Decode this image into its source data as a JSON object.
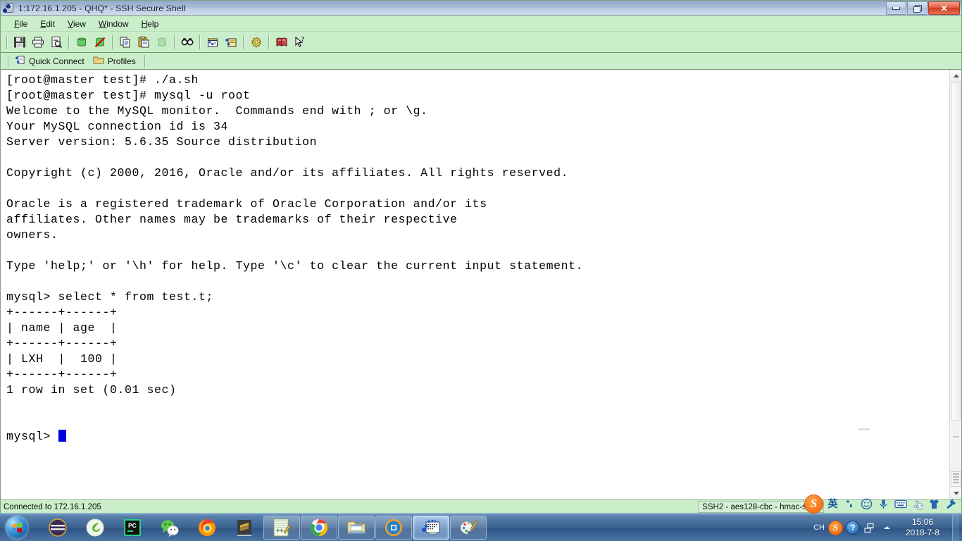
{
  "window": {
    "title": "1:172.16.1.205 - QHQ* - SSH Secure Shell",
    "app_icon": "ssh-terminal-icon",
    "controls": {
      "minimize": "Minimize",
      "restore": "Restore",
      "close": "Close"
    }
  },
  "menu": {
    "items": [
      {
        "label": "File",
        "accel": "F"
      },
      {
        "label": "Edit",
        "accel": "E"
      },
      {
        "label": "View",
        "accel": "V"
      },
      {
        "label": "Window",
        "accel": "W"
      },
      {
        "label": "Help",
        "accel": "H"
      }
    ]
  },
  "toolbar": {
    "buttons": [
      {
        "name": "save-icon",
        "title": "Save"
      },
      {
        "name": "print-icon",
        "title": "Print"
      },
      {
        "name": "print-preview-icon",
        "title": "Print Preview"
      },
      {
        "name": "connect-icon",
        "title": "Connect"
      },
      {
        "name": "disconnect-icon",
        "title": "Disconnect"
      },
      {
        "name": "copy-icon",
        "title": "Copy"
      },
      {
        "name": "paste-icon",
        "title": "Paste"
      },
      {
        "name": "new-terminal-icon",
        "title": "New Terminal"
      },
      {
        "name": "find-icon",
        "title": "Find"
      },
      {
        "name": "file-transfer-icon",
        "title": "New File Transfer"
      },
      {
        "name": "upload-dialog-icon",
        "title": "Upload Dialog"
      },
      {
        "name": "settings-icon",
        "title": "Settings"
      },
      {
        "name": "help-book-icon",
        "title": "Help"
      },
      {
        "name": "context-help-icon",
        "title": "Context Help"
      }
    ]
  },
  "quickbar": {
    "quick_connect": "Quick Connect",
    "profiles": "Profiles"
  },
  "terminal": {
    "lines": [
      "[root@master test]# ./a.sh",
      "[root@master test]# mysql -u root",
      "Welcome to the MySQL monitor.  Commands end with ; or \\g.",
      "Your MySQL connection id is 34",
      "Server version: 5.6.35 Source distribution",
      "",
      "Copyright (c) 2000, 2016, Oracle and/or its affiliates. All rights reserved.",
      "",
      "Oracle is a registered trademark of Oracle Corporation and/or its",
      "affiliates. Other names may be trademarks of their respective",
      "owners.",
      "",
      "Type 'help;' or '\\h' for help. Type '\\c' to clear the current input statement.",
      "",
      "mysql> select * from test.t;",
      "+------+------+",
      "| name | age  |",
      "+------+------+",
      "| LXH  |  100 |",
      "+------+------+",
      "1 row in set (0.01 sec)",
      "",
      ""
    ],
    "prompt": "mysql> ",
    "cursor": "block",
    "colors": {
      "background": "#ffffff",
      "foreground": "#000000",
      "cursor": "#0000e0"
    }
  },
  "query_result": {
    "statement": "select * from test.t;",
    "columns": [
      "name",
      "age"
    ],
    "rows": [
      [
        "LXH",
        "100"
      ]
    ],
    "summary": "1 row in set (0.01 sec)"
  },
  "statusbar": {
    "left": "Connected to 172.16.1.205",
    "right": "SSH2 - aes128-cbc - hmac-sha1"
  },
  "ime": {
    "items": [
      {
        "name": "sogou-logo-icon",
        "glyph": "S"
      },
      {
        "name": "language-mode-icon",
        "glyph": "英"
      },
      {
        "name": "punctuation-icon",
        "glyph": "’,"
      },
      {
        "name": "emoji-icon",
        "glyph": "☺"
      },
      {
        "name": "voice-input-icon",
        "glyph": "🎤"
      },
      {
        "name": "soft-keyboard-icon",
        "glyph": "⌨"
      },
      {
        "name": "toolbox-icon",
        "glyph": "17"
      },
      {
        "name": "skin-icon",
        "glyph": "👕"
      },
      {
        "name": "settings-wrench-icon",
        "glyph": "🔧"
      }
    ]
  },
  "taskbar": {
    "start": "Start",
    "tasks": [
      {
        "name": "task-eclipse",
        "label": "Eclipse"
      },
      {
        "name": "task-spring",
        "label": "Spring Tool Suite"
      },
      {
        "name": "task-pycharm",
        "label": "PyCharm"
      },
      {
        "name": "task-wechat",
        "label": "WeChat"
      },
      {
        "name": "task-firefox",
        "label": "Firefox"
      },
      {
        "name": "task-sublime",
        "label": "Sublime Text"
      },
      {
        "name": "task-notepadpp",
        "label": "Notepad++",
        "framed": true
      },
      {
        "name": "task-chrome",
        "label": "Google Chrome",
        "framed": true
      },
      {
        "name": "task-explorer",
        "label": "Windows Explorer",
        "framed": true
      },
      {
        "name": "task-vmware",
        "label": "VMware Workstation",
        "framed": true
      },
      {
        "name": "task-ssh",
        "label": "SSH Secure Shell",
        "framed": true,
        "active": true
      },
      {
        "name": "task-paint",
        "label": "Paint",
        "framed": true
      }
    ],
    "tray": {
      "language": "CH",
      "sogou": "S",
      "help": "?",
      "network": "network-icon",
      "show_hidden": "show-hidden-icons",
      "time": "15:06",
      "date": "2018-7-8"
    }
  }
}
